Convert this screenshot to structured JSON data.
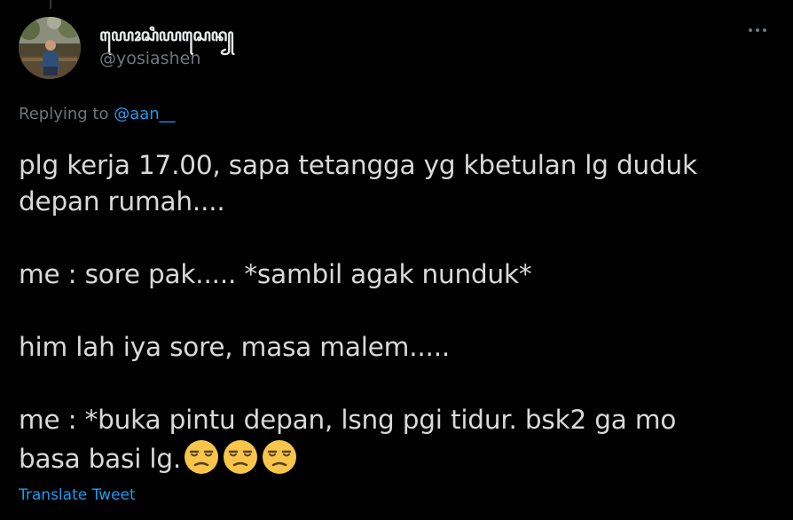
{
  "author": {
    "display_name": "ꦪꦺꦴꦱꦶꦪꦱꦺꦤ꧀",
    "handle": "@yosiashen"
  },
  "reply": {
    "prefix": "Replying to ",
    "mention": "@aan__"
  },
  "tweet": {
    "line1": "plg kerja 17.00, sapa tetangga yg kbetulan lg duduk",
    "line2": "depan rumah....",
    "line3": "me : sore pak..... *sambil agak nunduk*",
    "line4": "him  lah iya sore, masa malem.....",
    "line5": "me : *buka pintu depan, lsng pgi tidur. bsk2 ga mo",
    "line6": "basa basi lg.",
    "emojis": [
      "unamused-face-emoji",
      "unamused-face-emoji",
      "unamused-face-emoji"
    ]
  },
  "actions": {
    "translate_label": "Translate Tweet",
    "more_icon": "more-horizontal-icon"
  },
  "colors": {
    "background": "#000000",
    "accent": "#1d9bf0",
    "secondary_text": "#6e767d",
    "body_text": "#d9d9d9",
    "emoji_face": "#f6c54a"
  }
}
